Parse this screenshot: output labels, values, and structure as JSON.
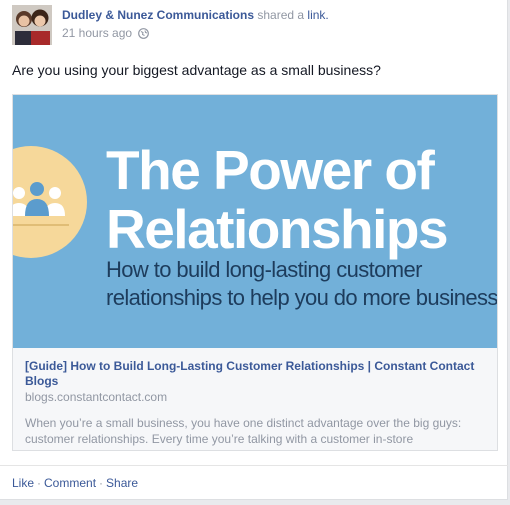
{
  "post": {
    "author": "Dudley & Nunez Communications",
    "shared_text": "shared a",
    "shared_link": "link.",
    "time": "21 hours ago",
    "privacy_icon": "globe-icon",
    "text": "Are you using your biggest advantage as a small business?"
  },
  "link_preview": {
    "hero_line1": "The Power of",
    "hero_line2": "Relationships",
    "hero_sub1": "How to build long-lasting customer",
    "hero_sub2": "relationships to help you do more business",
    "hero_icon": "people-group-icon",
    "title": "[Guide] How to Build Long-Lasting Customer Relationships | Constant Contact Blogs",
    "domain": "blogs.constantcontact.com",
    "description": "When you’re a small business, you have one distinct advantage over the big guys: customer relationships. Every time you’re talking with a customer in-store"
  },
  "actions": {
    "like": "Like",
    "comment": "Comment",
    "share": "Share",
    "separator": "·"
  },
  "colors": {
    "link": "#3b5998",
    "muted": "#9197a3",
    "hero_bg": "#72b0d9",
    "hero_circle": "#f6d89a"
  }
}
